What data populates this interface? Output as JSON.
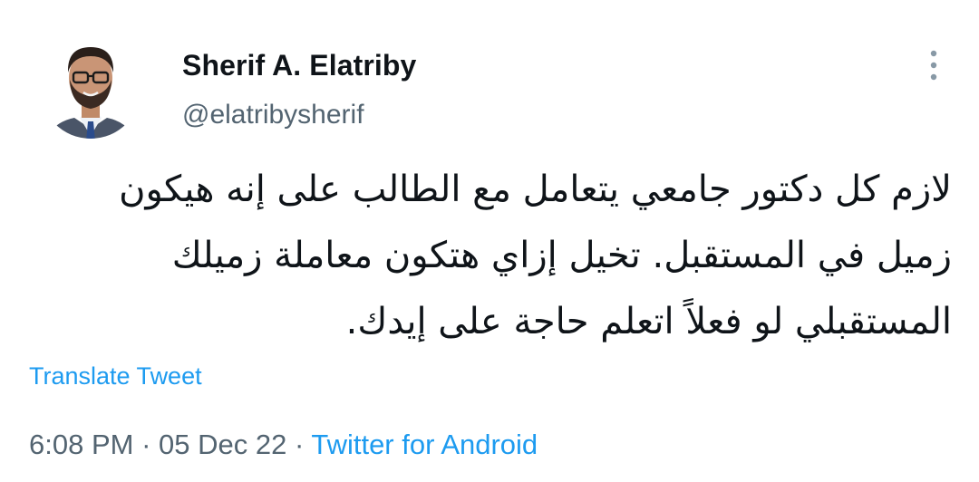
{
  "author": {
    "display_name": "Sherif A. Elatriby",
    "handle": "@elatribysherif"
  },
  "tweet": {
    "text": "لازم كل دكتور جامعي يتعامل مع الطالب على إنه هيكون\nزميل في المستقبل. تخيل إزاي هتكون معاملة زميلك\nالمستقبلي لو فعلاً اتعلم حاجة على إيدك."
  },
  "actions": {
    "translate_label": "Translate Tweet",
    "more_icon": "more-vertical-icon"
  },
  "meta": {
    "time": "6:08 PM",
    "separator1": " · ",
    "date": "05 Dec 22",
    "separator2": " · ",
    "source": "Twitter for Android"
  },
  "colors": {
    "link": "#1d9bf0",
    "secondary_text": "#536471",
    "primary_text": "#0f1419",
    "background": "#ffffff"
  }
}
